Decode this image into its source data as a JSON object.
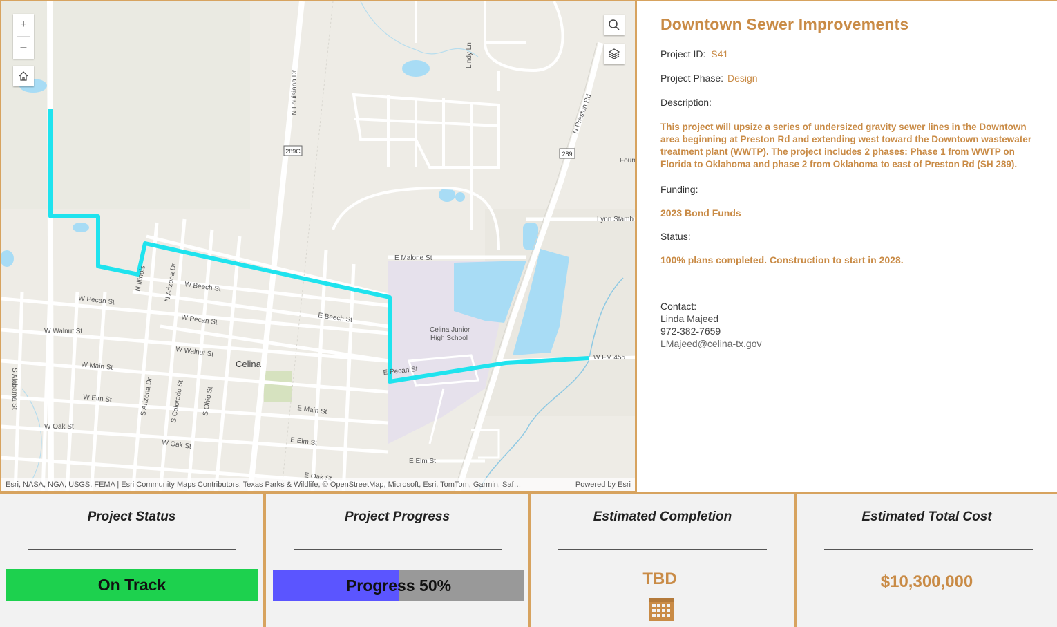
{
  "map": {
    "zoom_in": "+",
    "zoom_out": "–",
    "attribution": "Esri, NASA, NGA, USGS, FEMA | Esri Community Maps Contributors, Texas Parks & Wildlife, © OpenStreetMap, Microsoft, Esri, TomTom, Garmin, Saf…",
    "powered_by": "Powered by Esri",
    "labels": {
      "n_louisiana": "N Louisiana Dr",
      "lindy": "Lindy Ln",
      "n_preston": "N Preston Rd",
      "hwy289c": "289C",
      "hwy289": "289",
      "foun": "Foun",
      "lynn_stamb": "Lynn Stamb",
      "e_malone": "E Malone St",
      "w_beech": "W Beech St",
      "w_pecan1": "W Pecan St",
      "w_pecan2": "W Pecan St",
      "e_beech": "E Beech St",
      "w_walnut1": "W Walnut St",
      "w_walnut2": "W Walnut St",
      "w_main": "W Main St",
      "celina": "Celina",
      "w_elm": "W Elm St",
      "w_oak1": "W Oak St",
      "w_oak2": "W Oak St",
      "e_main": "E Main St",
      "e_elm1": "E Elm St",
      "e_elm2": "E Elm St",
      "e_oak": "E Oak St",
      "s_alabama": "S Alabama St",
      "s_arizona": "S Arizona Dr",
      "s_colorado": "S Colorado St",
      "s_ohio": "S Ohio St",
      "n_illinois": "N Illinois",
      "n_arizona": "N Arizona Dr",
      "school1": "Celina Junior",
      "school2": "High School",
      "w_fm455": "W FM 455",
      "e_pecan": "E Pecan St"
    }
  },
  "project": {
    "title": "Downtown Sewer Improvements",
    "id_label": "Project ID:",
    "id_value": "S41",
    "phase_label": "Project Phase:",
    "phase_value": "Design",
    "description_label": "Description:",
    "description": "This project will upsize a series of undersized gravity sewer lines in the Downtown area beginning at Preston Rd and extending west toward the Downtown wastewater treatment plant (WWTP). The project includes 2 phases: Phase 1 from WWTP on Florida to Oklahoma and phase 2 from Oklahoma to east of Preston Rd (SH 289).",
    "funding_label": "Funding:",
    "funding_value": "2023 Bond Funds",
    "status_label": "Status:",
    "status_value": "100% plans completed. Construction to start in 2028.",
    "contact_label": "Contact:",
    "contact_name": "Linda Majeed",
    "contact_phone": "972-382-7659",
    "contact_email": "LMajeed@celina-tx.gov"
  },
  "cards": {
    "status_title": "Project Status",
    "status_value": "On Track",
    "progress_title": "Project Progress",
    "progress_text": "Progress 50%",
    "progress_fraction": 0.5,
    "completion_title": "Estimated Completion",
    "completion_value": "TBD",
    "cost_title": "Estimated Total Cost",
    "cost_value": "$10,300,000"
  },
  "colors": {
    "accent": "#c98b46",
    "border": "#d7a35f",
    "on_track": "#1dd14e",
    "progress_fill": "#5b55ff",
    "progress_track": "#999999",
    "sewer_line": "#1fe3ee"
  }
}
